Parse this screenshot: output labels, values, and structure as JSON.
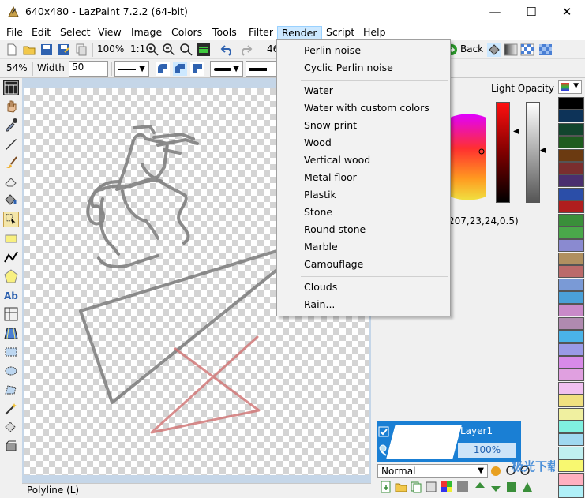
{
  "window": {
    "title": "640x480 - LazPaint 7.2.2 (64-bit)",
    "minimize": "—",
    "maximize": "☐",
    "close": "✕"
  },
  "menu": [
    "File",
    "Edit",
    "Select",
    "View",
    "Image",
    "Colors",
    "Tools",
    "Filter",
    "Render",
    "Script",
    "Help"
  ],
  "toolbar": {
    "zoom": "100%",
    "ratio": "1:1",
    "partial_value": "46",
    "back_label": "Back"
  },
  "options": {
    "zoom": "54%",
    "width_label": "Width",
    "width_value": "50"
  },
  "render_menu": {
    "group1": [
      "Perlin noise",
      "Cyclic Perlin noise"
    ],
    "group2": [
      "Water",
      "Water with custom colors",
      "Snow print",
      "Wood",
      "Vertical wood",
      "Metal floor",
      "Plastik",
      "Stone",
      "Round stone",
      "Marble",
      "Camouflage"
    ],
    "group3": [
      "Clouds",
      "Rain..."
    ]
  },
  "color_panel": {
    "title": "Light Opacity",
    "rgba": "207,23,24,0.5)"
  },
  "layer": {
    "name": "Layer1",
    "opacity": "100%"
  },
  "blend_mode": "Normal",
  "status": "Polyline (L)",
  "watermark": "极光下载站",
  "palette": [
    "#000000",
    "#0d3358",
    "#13452e",
    "#1f5c1f",
    "#6b3a11",
    "#7a2e2e",
    "#4a2f6e",
    "#2b4ea8",
    "#b01e1e",
    "#3a8f3a",
    "#4aa84a",
    "#8a8ad0",
    "#b09060",
    "#bb6a6a",
    "#7a9ad6",
    "#4aa0d8",
    "#c98ac9",
    "#b08ab0",
    "#4ab3e8",
    "#9a9ae6",
    "#d88ae8",
    "#e0a0e0",
    "#f0c0f0",
    "#f0e080",
    "#f0f0a0",
    "#80f0e0",
    "#a0d8f0",
    "#c0f0f0",
    "#f8f870",
    "#ffb0c0",
    "#b0f0f8"
  ]
}
